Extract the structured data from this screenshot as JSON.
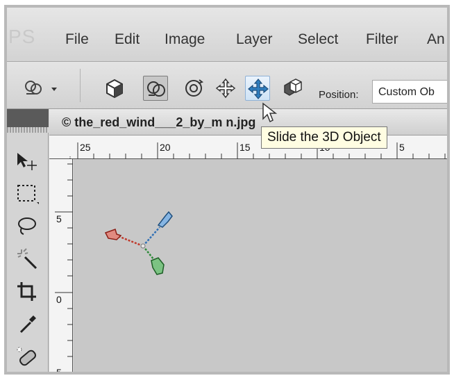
{
  "app": {
    "logo": "PS"
  },
  "menu": {
    "items": [
      "File",
      "Edit",
      "Image",
      "Layer",
      "Select",
      "Filter",
      "An"
    ]
  },
  "options_bar": {
    "position_label": "Position:",
    "position_value": "Custom Ob",
    "tools": [
      "3d-object-rotate-icon",
      "3d-rotate-icon",
      "3d-roll-icon",
      "3d-drag-icon",
      "3d-slide-icon",
      "3d-scale-icon"
    ]
  },
  "document": {
    "title": "© the_red_wind___2_by_m            n.jpg"
  },
  "ruler": {
    "top": [
      "25",
      "20",
      "15",
      "10",
      "5"
    ],
    "left": [
      "5",
      "0",
      "5"
    ]
  },
  "tooltip": {
    "text": "Slide the 3D Object"
  },
  "colors": {
    "canvas": "#c8c8c8",
    "tooltip_bg": "#fffde2",
    "highlight": "#2f7fc1"
  }
}
